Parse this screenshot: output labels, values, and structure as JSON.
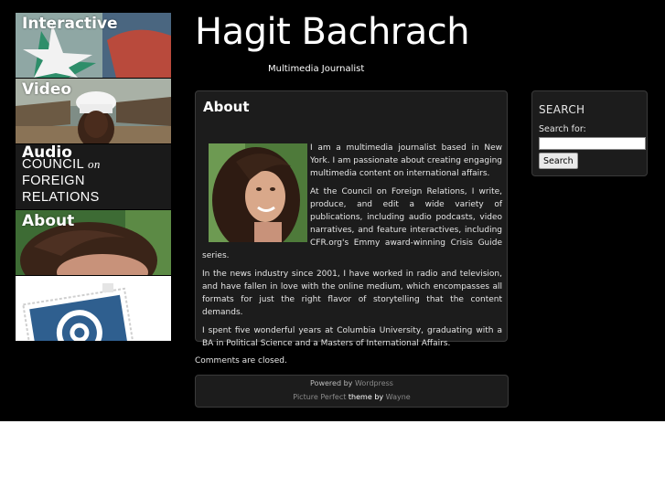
{
  "header": {
    "title": "Hagit Bachrach",
    "tagline": "Multimedia Journalist"
  },
  "nav": {
    "items": [
      {
        "label": "Interactive",
        "image": "cfr-flag-interactive-photo"
      },
      {
        "label": "Video",
        "image": "chef-portrait-photo"
      },
      {
        "label": "Audio",
        "image": "cfr-logo"
      },
      {
        "label": "About",
        "image": "author-photo"
      },
      {
        "label": "",
        "image": "email-stamp-icon"
      }
    ],
    "cfr_logo": {
      "line1": "COUNCIL",
      "line1_suffix": "on",
      "line2": "FOREIGN",
      "line3": "RELATIONS"
    }
  },
  "post": {
    "title": "About",
    "image": "author-portrait",
    "paragraphs": [
      "I am a multimedia journalist based in New York. I am passionate about creating engaging multimedia content on international affairs.",
      "At the Council on Foreign Relations, I write, produce, and edit a wide variety of publications, including audio podcasts, video narratives, and feature interactives, including CFR.org's Emmy award-winning Crisis Guide series.",
      "In the news industry since 2001, I have worked in radio and television, and have fallen in love with the online medium, which encompasses all formats for just the right flavor of storytelling that the content demands.",
      "I spent five wonderful years at Columbia University, graduating with a BA in Political Science and a Masters of International Affairs."
    ]
  },
  "comments_status": "Comments are closed.",
  "footer": {
    "powered_by": "Powered by",
    "powered_link": "Wordpress",
    "theme_name": "Picture Perfect",
    "theme_word": "theme",
    "by_word": "by",
    "author_link": "Wayne"
  },
  "sidebar": {
    "search_title": "SEARCH",
    "search_label": "Search for:",
    "search_value": "",
    "search_button": "Search"
  },
  "colors": {
    "page_bg": "#000000",
    "panel_bg": "#1c1c1c",
    "panel_border": "#3a3a3a",
    "text": "#e6e6e6",
    "link_gray": "#8a8a8a"
  }
}
